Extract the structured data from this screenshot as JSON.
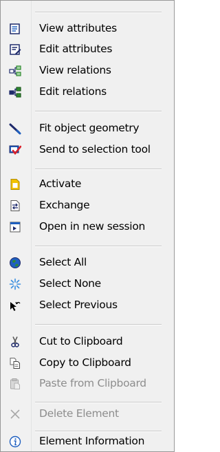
{
  "menu": {
    "items": [
      {
        "label": "View attributes",
        "icon": "view-attributes-icon"
      },
      {
        "label": "Edit attributes",
        "icon": "edit-attributes-icon"
      },
      {
        "label": "View relations",
        "icon": "view-relations-icon"
      },
      {
        "label": "Edit relations",
        "icon": "edit-relations-icon"
      },
      {
        "label": "Fit object geometry",
        "icon": "fit-geometry-icon"
      },
      {
        "label": "Send to selection tool",
        "icon": "send-to-selection-tool-icon"
      },
      {
        "label": "Activate",
        "icon": "activate-icon"
      },
      {
        "label": "Exchange",
        "icon": "exchange-icon"
      },
      {
        "label": "Open in new session",
        "icon": "open-in-new-session-icon"
      },
      {
        "label": "Select All",
        "icon": "select-all-icon"
      },
      {
        "label": "Select None",
        "icon": "select-none-icon"
      },
      {
        "label": "Select Previous",
        "icon": "select-previous-icon"
      },
      {
        "label": "Cut to Clipboard",
        "icon": "cut-icon"
      },
      {
        "label": "Copy to Clipboard",
        "icon": "copy-icon"
      },
      {
        "label": "Paste from Clipboard",
        "icon": "paste-icon",
        "disabled": true
      },
      {
        "label": "Delete Element",
        "icon": "delete-icon",
        "disabled": true
      },
      {
        "label": "Element Information",
        "icon": "info-icon"
      }
    ]
  },
  "colors": {
    "menu_background": "#f0f0f0",
    "disabled_text": "#8d8d8d",
    "icon_blue": "#1f5fbf",
    "icon_navy": "#1e2a6b",
    "icon_green": "#2f8a2f",
    "icon_red": "#d9202b",
    "icon_yellow": "#f2c200"
  }
}
